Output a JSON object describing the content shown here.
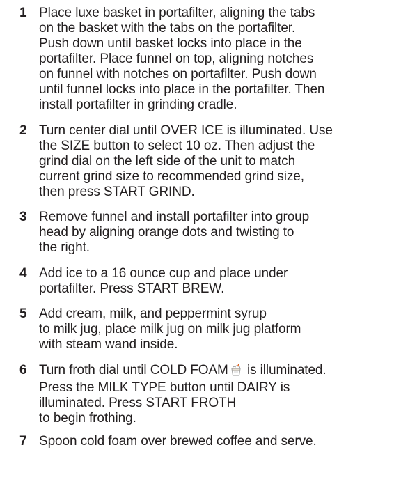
{
  "steps": [
    {
      "number": "1",
      "lines": [
        "Place luxe basket in portafilter, aligning the tabs",
        "on the basket with the tabs on the portafilter.",
        "Push down until basket locks into place in the",
        "portafilter. Place funnel on top, aligning notches",
        "on funnel with notches on portafilter. Push down",
        "until funnel locks into place in the portafilter. Then",
        "install portafilter in grinding cradle."
      ]
    },
    {
      "number": "2",
      "lines": [
        "Turn center dial until OVER ICE is illuminated. Use",
        "the SIZE button to select 10 oz. Then adjust the",
        "grind dial on the left side of the unit to match",
        "current grind size to recommended grind size,",
        "then press START GRIND."
      ]
    },
    {
      "number": "3",
      "lines": [
        "Remove funnel and install portafilter into group",
        "head by aligning orange dots and twisting to",
        "the right."
      ]
    },
    {
      "number": "4",
      "lines": [
        "Add ice to a 16 ounce cup and place under",
        "portafilter. Press START BREW."
      ]
    },
    {
      "number": "5",
      "lines": [
        "Add cream, milk, and peppermint syrup",
        "to milk jug, place milk jug on milk jug platform",
        "with steam wand inside."
      ]
    },
    {
      "number": "6",
      "line1_before_icon": "Turn froth dial until COLD FOAM",
      "line1_after_icon": "is illuminated.",
      "icon": "cold-foam-cup-icon",
      "lines": [
        "Press the MILK TYPE button until DAIRY is",
        "illuminated. Press START FROTH",
        "to begin frothing."
      ]
    },
    {
      "number": "7",
      "lines": [
        "Spoon cold foam over brewed coffee and serve."
      ]
    }
  ]
}
